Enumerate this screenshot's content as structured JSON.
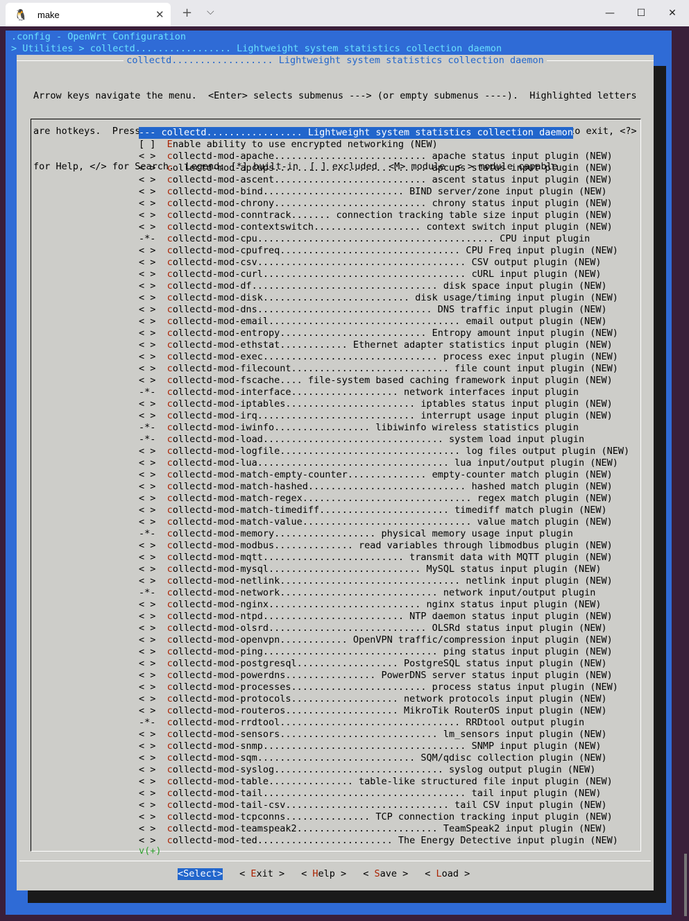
{
  "window": {
    "tab_title": "make",
    "tab_icon": "linux-penguin-icon",
    "new_tab": "+",
    "dropdown": "⌵",
    "close": "✕",
    "minimize": "—",
    "maximize": "☐"
  },
  "header": {
    "line1": ".config - OpenWrt Configuration",
    "line2": "> Utilities > collectd................. Lightweight system statistics collection daemon"
  },
  "dialog": {
    "title": "collectd.................. Lightweight system statistics collection daemon",
    "help": [
      "Arrow keys navigate the menu.  <Enter> selects submenus ---> (or empty submenus ----).  Highlighted letters",
      "are hotkeys.  Pressing <Y> includes, <N> excludes, <M> modularizes features.  Press <Esc><Esc> to exit, <?>",
      "for Help, </> for Search.  Legend: [*] built-in  [ ] excluded  <M> module  < > module capable"
    ],
    "selected_item": "--- collectd................. Lightweight system statistics collection daemon",
    "items": [
      {
        "mark": "[ ]",
        "text": "Enable ability to use encrypted networking (NEW)"
      },
      {
        "mark": "< >",
        "text": "collectd-mod-apache........................... apache status input plugin (NEW)"
      },
      {
        "mark": "< >",
        "text": "collectd-mod-apcups........................... apcups status input plugin (NEW)"
      },
      {
        "mark": "< >",
        "text": "collectd-mod-ascent........................... ascent status input plugin (NEW)"
      },
      {
        "mark": "< >",
        "text": "collectd-mod-bind......................... BIND server/zone input plugin (NEW)"
      },
      {
        "mark": "< >",
        "text": "collectd-mod-chrony........................... chrony status input plugin (NEW)"
      },
      {
        "mark": "< >",
        "text": "collectd-mod-conntrack....... connection tracking table size input plugin (NEW)"
      },
      {
        "mark": "< >",
        "text": "collectd-mod-contextswitch................... context switch input plugin (NEW)"
      },
      {
        "mark": "-*-",
        "text": "collectd-mod-cpu.......................................... CPU input plugin"
      },
      {
        "mark": "< >",
        "text": "collectd-mod-cpufreq................................ CPU Freq input plugin (NEW)"
      },
      {
        "mark": "< >",
        "text": "collectd-mod-csv..................................... CSV output plugin (NEW)"
      },
      {
        "mark": "< >",
        "text": "collectd-mod-curl.................................... cURL input plugin (NEW)"
      },
      {
        "mark": "< >",
        "text": "collectd-mod-df................................. disk space input plugin (NEW)"
      },
      {
        "mark": "< >",
        "text": "collectd-mod-disk.......................... disk usage/timing input plugin (NEW)"
      },
      {
        "mark": "< >",
        "text": "collectd-mod-dns............................... DNS traffic input plugin (NEW)"
      },
      {
        "mark": "< >",
        "text": "collectd-mod-email.................................. email output plugin (NEW)"
      },
      {
        "mark": "< >",
        "text": "collectd-mod-entropy.......................... Entropy amount input plugin (NEW)"
      },
      {
        "mark": "< >",
        "text": "collectd-mod-ethstat............ Ethernet adapter statistics input plugin (NEW)"
      },
      {
        "mark": "< >",
        "text": "collectd-mod-exec............................... process exec input plugin (NEW)"
      },
      {
        "mark": "< >",
        "text": "collectd-mod-filecount............................ file count input plugin (NEW)"
      },
      {
        "mark": "< >",
        "text": "collectd-mod-fscache.... file-system based caching framework input plugin (NEW)"
      },
      {
        "mark": "-*-",
        "text": "collectd-mod-interface................... network interfaces input plugin"
      },
      {
        "mark": "< >",
        "text": "collectd-mod-iptables....................... iptables status input plugin (NEW)"
      },
      {
        "mark": "< >",
        "text": "collectd-mod-irq............................ interrupt usage input plugin (NEW)"
      },
      {
        "mark": "-*-",
        "text": "collectd-mod-iwinfo................. libiwinfo wireless statistics plugin"
      },
      {
        "mark": "-*-",
        "text": "collectd-mod-load................................ system load input plugin"
      },
      {
        "mark": "< >",
        "text": "collectd-mod-logfile................................ log files output plugin (NEW)"
      },
      {
        "mark": "< >",
        "text": "collectd-mod-lua.................................. lua input/output plugin (NEW)"
      },
      {
        "mark": "< >",
        "text": "collectd-mod-match-empty-counter.............. empty-counter match plugin (NEW)"
      },
      {
        "mark": "< >",
        "text": "collectd-mod-match-hashed............................ hashed match plugin (NEW)"
      },
      {
        "mark": "< >",
        "text": "collectd-mod-match-regex.............................. regex match plugin (NEW)"
      },
      {
        "mark": "< >",
        "text": "collectd-mod-match-timediff....................... timediff match plugin (NEW)"
      },
      {
        "mark": "< >",
        "text": "collectd-mod-match-value.............................. value match plugin (NEW)"
      },
      {
        "mark": "-*-",
        "text": "collectd-mod-memory.................. physical memory usage input plugin"
      },
      {
        "mark": "< >",
        "text": "collectd-mod-modbus.............. read variables through libmodbus plugin (NEW)"
      },
      {
        "mark": "< >",
        "text": "collectd-mod-mqtt......................... transmit data with MQTT plugin (NEW)"
      },
      {
        "mark": "< >",
        "text": "collectd-mod-mysql........................... MySQL status input plugin (NEW)"
      },
      {
        "mark": "< >",
        "text": "collectd-mod-netlink................................ netlink input plugin (NEW)"
      },
      {
        "mark": "-*-",
        "text": "collectd-mod-network............................ network input/output plugin"
      },
      {
        "mark": "< >",
        "text": "collectd-mod-nginx........................... nginx status input plugin (NEW)"
      },
      {
        "mark": "< >",
        "text": "collectd-mod-ntpd......................... NTP daemon status input plugin (NEW)"
      },
      {
        "mark": "< >",
        "text": "collectd-mod-olsrd............................ OLSRd status input plugin (NEW)"
      },
      {
        "mark": "< >",
        "text": "collectd-mod-openvpn............ OpenVPN traffic/compression input plugin (NEW)"
      },
      {
        "mark": "< >",
        "text": "collectd-mod-ping............................... ping status input plugin (NEW)"
      },
      {
        "mark": "< >",
        "text": "collectd-mod-postgresql.................. PostgreSQL status input plugin (NEW)"
      },
      {
        "mark": "< >",
        "text": "collectd-mod-powerdns................ PowerDNS server status input plugin (NEW)"
      },
      {
        "mark": "< >",
        "text": "collectd-mod-processes........................ process status input plugin (NEW)"
      },
      {
        "mark": "< >",
        "text": "collectd-mod-protocols................... network protocols input plugin (NEW)"
      },
      {
        "mark": "< >",
        "text": "collectd-mod-routeros.................... MikroTik RouterOS input plugin (NEW)"
      },
      {
        "mark": "-*-",
        "text": "collectd-mod-rrdtool................................ RRDtool output plugin"
      },
      {
        "mark": "< >",
        "text": "collectd-mod-sensors............................ lm_sensors input plugin (NEW)"
      },
      {
        "mark": "< >",
        "text": "collectd-mod-snmp.................................... SNMP input plugin (NEW)"
      },
      {
        "mark": "< >",
        "text": "collectd-mod-sqm............................ SQM/qdisc collection plugin (NEW)"
      },
      {
        "mark": "< >",
        "text": "collectd-mod-syslog.............................. syslog output plugin (NEW)"
      },
      {
        "mark": "< >",
        "text": "collectd-mod-table............... table-like structured file input plugin (NEW)"
      },
      {
        "mark": "< >",
        "text": "collectd-mod-tail.................................... tail input plugin (NEW)"
      },
      {
        "mark": "< >",
        "text": "collectd-mod-tail-csv............................. tail CSV input plugin (NEW)"
      },
      {
        "mark": "< >",
        "text": "collectd-mod-tcpconns............... TCP connection tracking input plugin (NEW)"
      },
      {
        "mark": "< >",
        "text": "collectd-mod-teamspeak2......................... TeamSpeak2 input plugin (NEW)"
      },
      {
        "mark": "< >",
        "text": "collectd-mod-ted........................ The Energy Detective input plugin (NEW)"
      }
    ],
    "more_indicator": "v(+)",
    "buttons": [
      {
        "pre": "<",
        "key": "S",
        "rest": "elect",
        "post": ">",
        "active": true
      },
      {
        "pre": "< ",
        "key": "E",
        "rest": "xit",
        "post": " >",
        "active": false
      },
      {
        "pre": "< ",
        "key": "H",
        "rest": "elp",
        "post": " >",
        "active": false
      },
      {
        "pre": "< ",
        "key": "S",
        "rest": "ave",
        "post": " >",
        "active": false
      },
      {
        "pre": "< ",
        "key": "L",
        "rest": "oad",
        "post": " >",
        "active": false
      }
    ]
  }
}
